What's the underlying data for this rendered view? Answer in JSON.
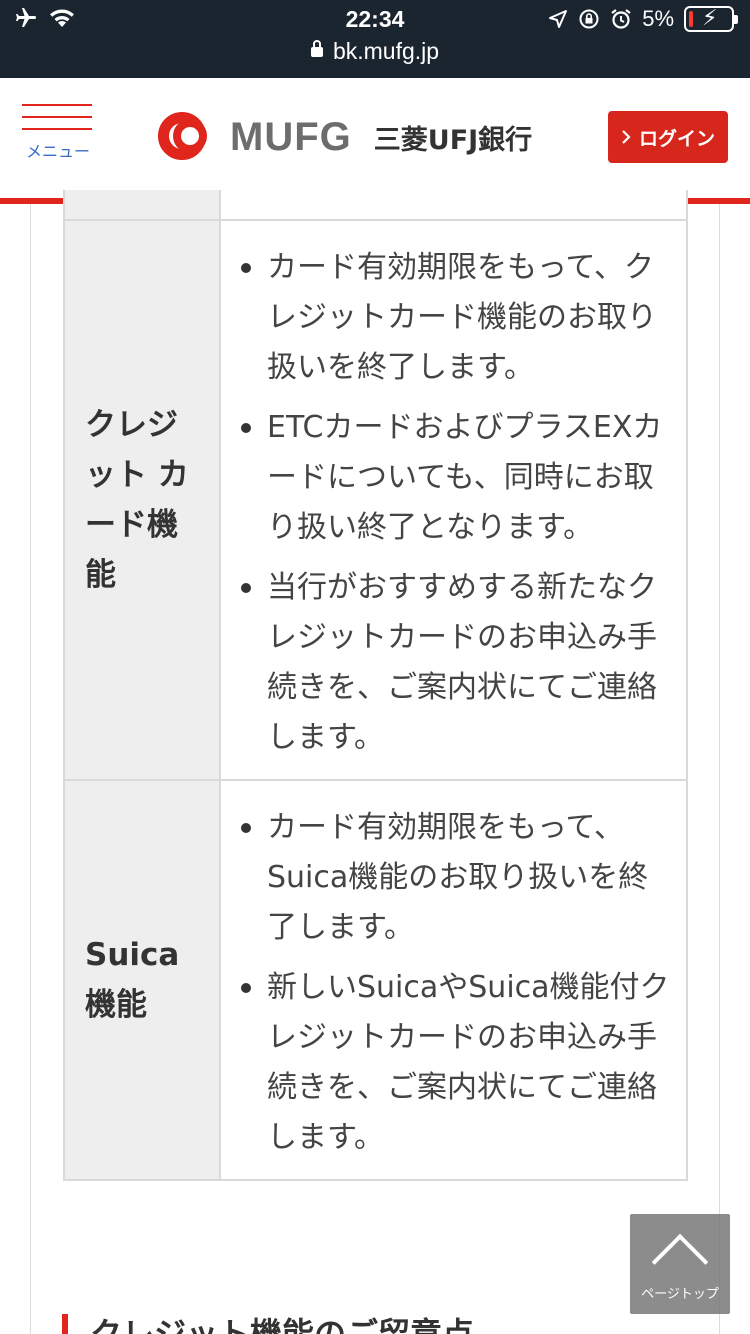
{
  "status_bar": {
    "time": "22:34",
    "battery_percent": "5%",
    "battery_level": 0.05,
    "url": "bk.mufg.jp",
    "icons": [
      "airplane-icon",
      "wifi-icon",
      "location-icon",
      "orientation-lock-icon",
      "alarm-icon",
      "battery-icon"
    ]
  },
  "header": {
    "menu_label": "メニュー",
    "logo_text": "MUFG",
    "bank_name": "三菱UFJ銀行",
    "login_label": "ログイン",
    "accent_color": "#e0261c",
    "menu_color": "#3b6cc5"
  },
  "table": {
    "rows": [
      {
        "heading": "クレジット カード機能",
        "items": [
          "カード有効期限をもって、クレジットカード機能のお取り扱いを終了します。",
          "ETCカードおよびプラスEXカードについても、同時にお取り扱い終了となります。",
          "当行がおすすめする新たなクレジットカードのお申込み手続きを、ご案内状にてご連絡します。"
        ]
      },
      {
        "heading": "Suica機能",
        "items": [
          "カード有効期限をもって、Suica機能のお取り扱いを終了します。",
          "新しいSuicaやSuica機能付クレジットカードのお申込み手続きを、ご案内状にてご連絡します。"
        ]
      }
    ]
  },
  "section_heading": "クレジット機能のご留意点",
  "page_top_label": "ページトップ"
}
